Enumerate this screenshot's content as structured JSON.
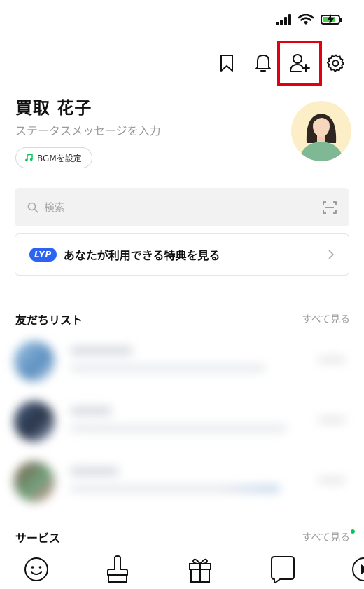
{
  "status_bar": {
    "signal_icon": "cellular-signal-icon",
    "wifi_icon": "wifi-icon",
    "battery_icon": "battery-charging-icon",
    "battery_color": "#4ad04a"
  },
  "header": {
    "icons": [
      "bookmark-icon",
      "bell-icon",
      "add-friend-icon",
      "settings-gear-icon"
    ],
    "highlight_color": "#e00010"
  },
  "profile": {
    "name": "買取 花子",
    "status_message_placeholder": "ステータスメッセージを入力",
    "bgm_label": "BGMを設定"
  },
  "search": {
    "placeholder": "検索"
  },
  "benefit": {
    "badge": "LYP",
    "text": "あなたが利用できる特典を見る",
    "badge_color": "#2b64f3"
  },
  "friends": {
    "title": "友だちリスト",
    "see_all": "すべて見る"
  },
  "services": {
    "title": "サービス",
    "see_all": "すべて見る",
    "new_dot_color": "#06c755"
  },
  "bottom_icons": [
    "smiley-icon",
    "brush-icon",
    "gift-icon",
    "speech-bubble-icon",
    "play-icon"
  ]
}
